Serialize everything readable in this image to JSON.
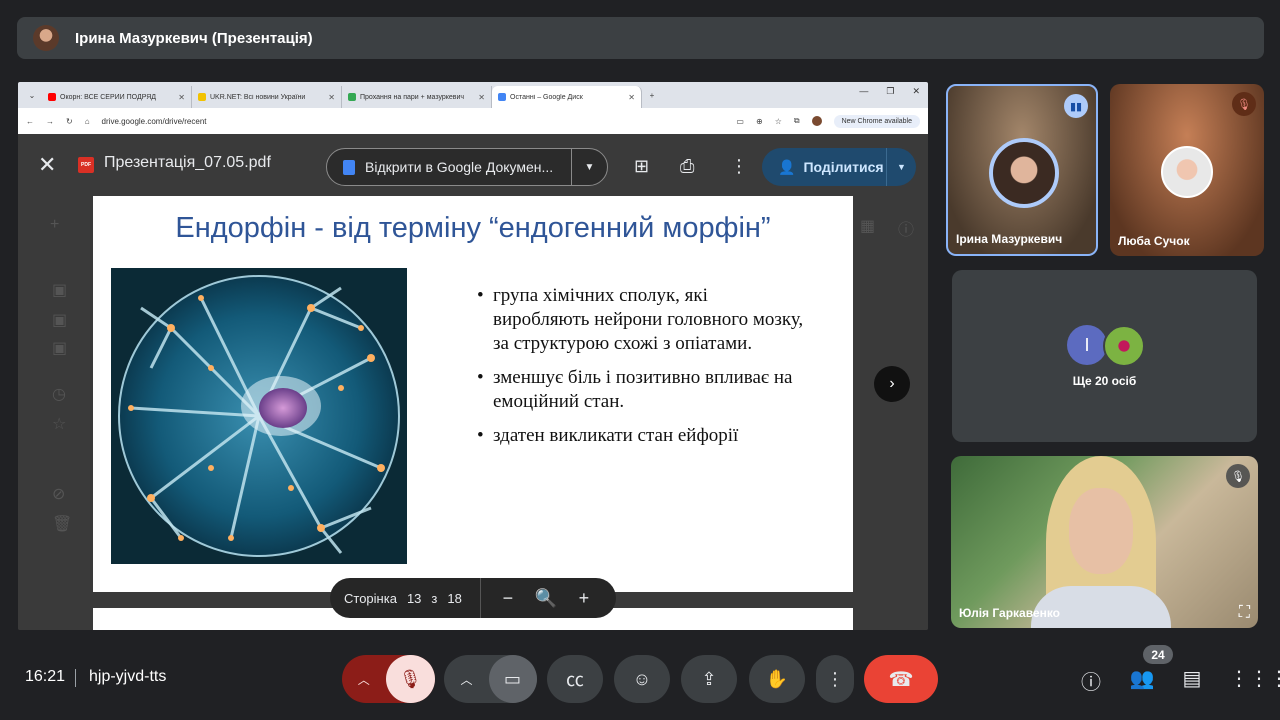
{
  "presenter_bar": {
    "title": "Ірина Мазуркевич (Презентація)"
  },
  "browser": {
    "tabs": [
      {
        "label": "Окорн: ВСЕ СЕРИИ ПОДРЯД",
        "fav_color": "#ff0000"
      },
      {
        "label": "UKR.NET: Всі новини України",
        "fav_color": "#f2c200"
      },
      {
        "label": "Прохання на пари + мазуркевич",
        "fav_color": "#34a853"
      },
      {
        "label": "Останні – Google Диск",
        "fav_color": "#4285f4"
      }
    ],
    "url": "drive.google.com/drive/recent",
    "new_chrome": "New Chrome available"
  },
  "viewer": {
    "file_name": "Презентація_07.05.pdf",
    "pdf_badge": "PDF",
    "open_with": "Відкрити в Google Докумен...",
    "share": "Поділитися"
  },
  "slide": {
    "title": "Ендорфін - від терміну “ендогенний морфін”",
    "bullets": [
      "група хімічних сполук, які виробляють нейрони головного мозку, за структурою схожі з опіатами.",
      "зменшує біль і позитивно впливає на емоційний стан.",
      "здатен викликати стан ейфорії"
    ]
  },
  "pager": {
    "label": "Сторінка",
    "current": "13",
    "of": "з",
    "total": "18"
  },
  "participants": {
    "iryna": "Ірина Мазуркевич",
    "liuba": "Люба Сучок",
    "more_initial": "I",
    "more_label": "Ще 20 осіб",
    "yulia": "Юлія Гаркавенко"
  },
  "bottom": {
    "time": "16:21",
    "meeting_code": "hjp-yjvd-tts",
    "people_count": "24"
  }
}
